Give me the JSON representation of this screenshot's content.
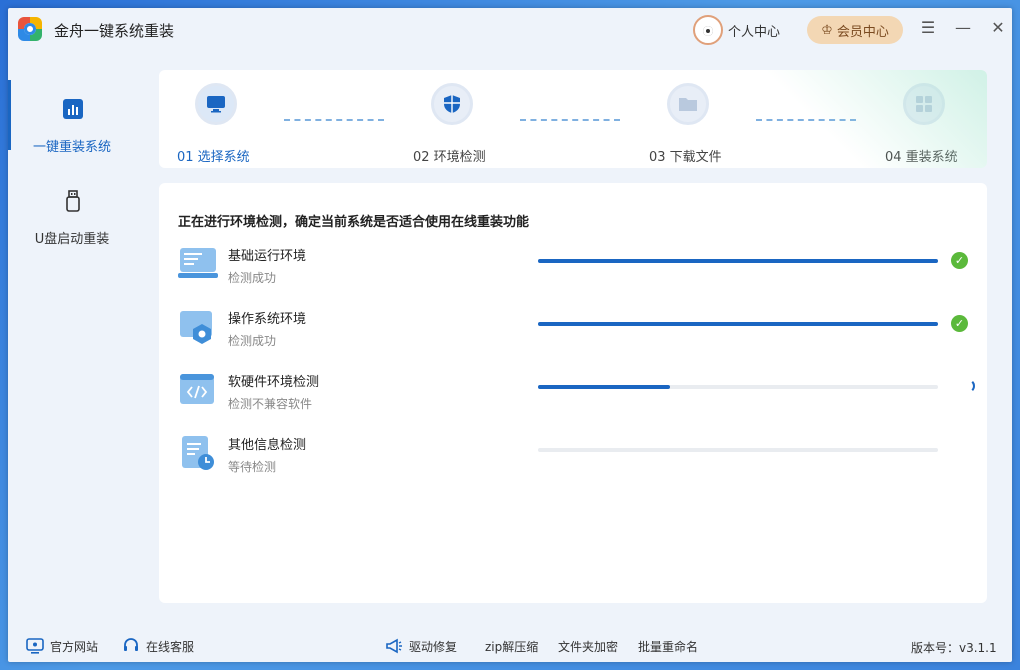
{
  "app": {
    "title": "金舟一键系统重装"
  },
  "header": {
    "user_center": "个人中心",
    "vip_center": "会员中心"
  },
  "sidebar": {
    "items": [
      {
        "label": "一键重装系统",
        "icon": "chart-bars-icon",
        "active": true
      },
      {
        "label": "U盘启动重装",
        "icon": "usb-drive-icon",
        "active": false
      }
    ]
  },
  "steps": [
    {
      "label": "01 选择系统",
      "icon": "monitor-icon",
      "state": "active"
    },
    {
      "label": "02 环境检测",
      "icon": "shield-icon",
      "state": "current"
    },
    {
      "label": "03 下载文件",
      "icon": "folder-icon",
      "state": "pending"
    },
    {
      "label": "04 重装系统",
      "icon": "windows-icon",
      "state": "pending"
    }
  ],
  "main": {
    "heading": "正在进行环境检测，确定当前系统是否适合使用在线重装功能",
    "checks": [
      {
        "name": "基础运行环境",
        "status": "检测成功",
        "progress": 1.0,
        "result": "ok",
        "icon": "laptop-icon"
      },
      {
        "name": "操作系统环境",
        "status": "检测成功",
        "progress": 1.0,
        "result": "ok",
        "icon": "os-gear-icon"
      },
      {
        "name": "软硬件环境检测",
        "status": "检测不兼容软件",
        "progress": 0.33,
        "result": "running",
        "icon": "code-window-icon"
      },
      {
        "name": "其他信息检测",
        "status": "等待检测",
        "progress": 0.0,
        "result": "waiting",
        "icon": "doc-clock-icon"
      }
    ]
  },
  "footer": {
    "links": [
      {
        "label": "官方网站",
        "icon": "monitor-link-icon"
      },
      {
        "label": "在线客服",
        "icon": "headset-icon"
      },
      {
        "label": "驱动修复",
        "icon": "megaphone-icon"
      },
      {
        "label": "zip解压缩",
        "icon": ""
      },
      {
        "label": "文件夹加密",
        "icon": ""
      },
      {
        "label": "批量重命名",
        "icon": ""
      }
    ],
    "version": "版本号：v3.1.1"
  },
  "colors": {
    "accent": "#1a66c2",
    "success": "#5bb93b",
    "vip_bg": "#f3d7b4"
  }
}
